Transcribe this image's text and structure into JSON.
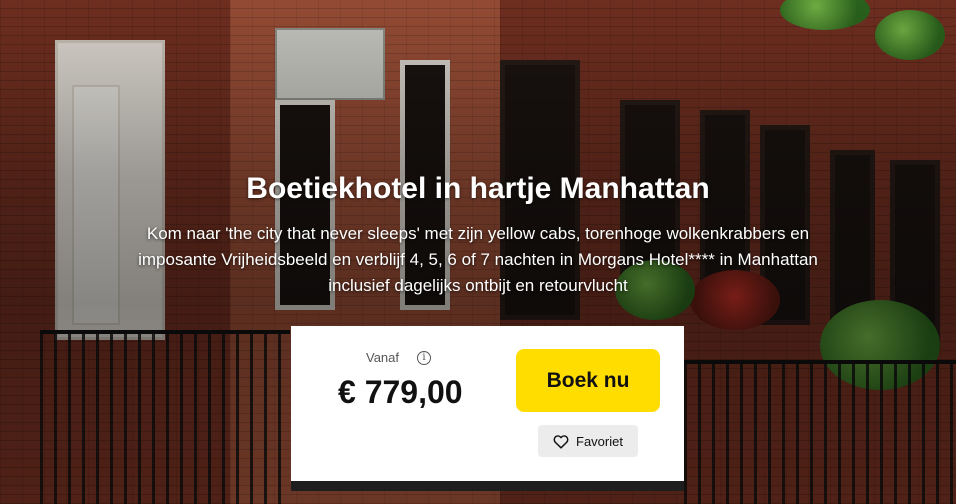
{
  "hero": {
    "title": "Boetiekhotel in hartje Manhattan",
    "description": "Kom naar 'the city that never sleeps' met zijn yellow cabs, torenhoge wolkenkrabbers en imposante Vrijheidsbeeld en verblijf 4, 5, 6 of 7 nachten in Morgans Hotel**** in Manhattan inclusief dagelijks ontbijt en retourvlucht"
  },
  "booking": {
    "from_label": "Vanaf",
    "info_icon": "info-icon",
    "price": "€ 779,00",
    "book_label": "Boek nu",
    "favorite_label": "Favoriet",
    "favorite_icon": "heart-outline-icon"
  },
  "colors": {
    "book_button": "#ffdd00",
    "favorite_button": "#ececec"
  }
}
